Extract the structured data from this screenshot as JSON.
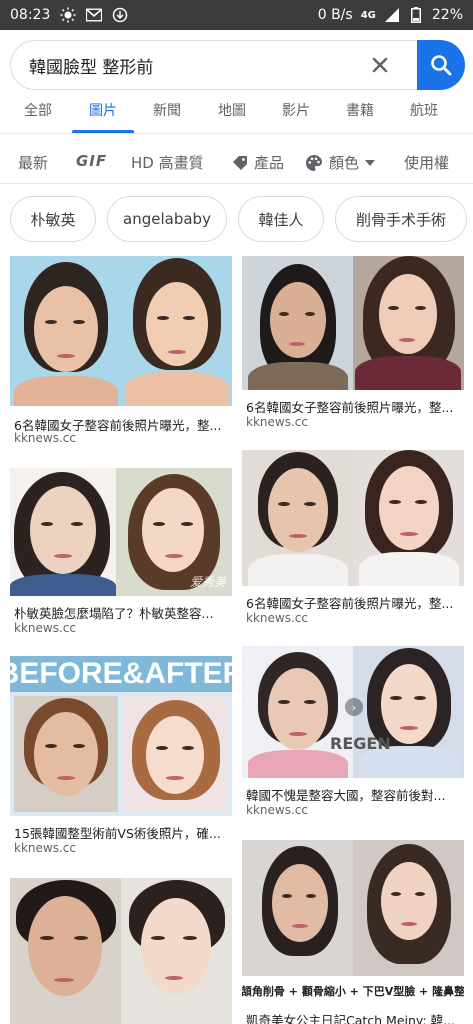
{
  "status": {
    "time": "08:23",
    "speed": "0 B/s",
    "network": "4G",
    "battery": "22%"
  },
  "search": {
    "query": "韓國臉型 整形前"
  },
  "tabs": [
    "全部",
    "圖片",
    "新聞",
    "地圖",
    "影片",
    "書籍",
    "航班"
  ],
  "active_tab": "圖片",
  "tools": {
    "newest": "最新",
    "gif": "GIF",
    "hd": "HD 高畫質",
    "product": "產品",
    "color": "顏色",
    "usage": "使用權"
  },
  "chips": [
    "朴敏英",
    "angelababy",
    "韓佳人",
    "削骨手术手術"
  ],
  "results": [
    {
      "title": "6名韓國女子整容前後照片曝光，整...",
      "site": "kknews.cc"
    },
    {
      "title": "6名韓國女子整容前後照片曝光，整...",
      "site": "kknews.cc"
    },
    {
      "title": "朴敏英臉怎麼塌陷了？朴敏英整容...",
      "site": "kknews.cc",
      "watermark": "爱秀美"
    },
    {
      "title": "6名韓國女子整容前後照片曝光，整...",
      "site": "kknews.cc"
    },
    {
      "title": "15張韓國整型術前VS術後照片，確...",
      "site": "kknews.cc",
      "banner": "BEFORE&AFTER"
    },
    {
      "title": "韓國不愧是整容大國，整容前後對...",
      "site": "kknews.cc",
      "watermark": "REGEN"
    },
    {
      "title": "",
      "site": ""
    },
    {
      "title": "凱奇美女公主日記Catch Meiny: 韓...",
      "site": "",
      "caption": "下頷角削骨 + 顴骨縮小 + 下巴V型臉 + 隆鼻整形"
    }
  ]
}
